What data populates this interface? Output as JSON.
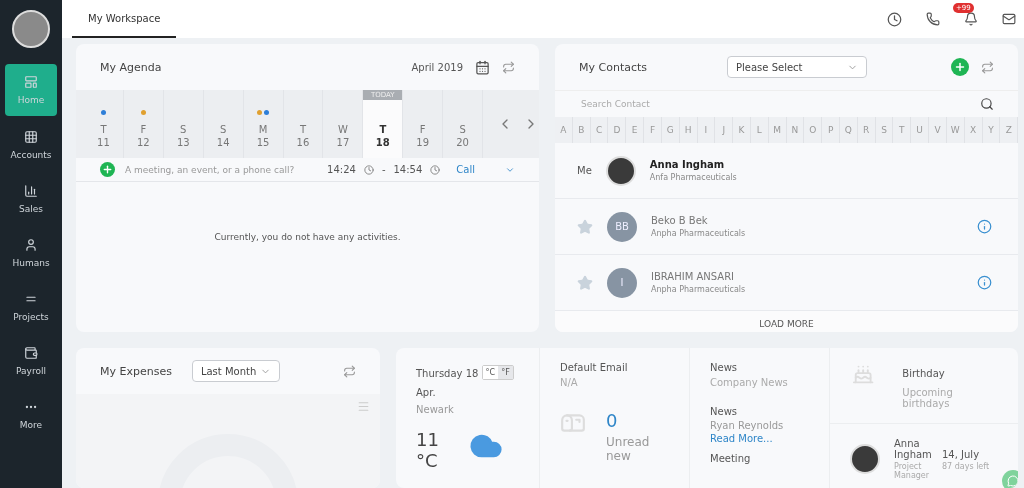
{
  "sidebar": {
    "items": [
      {
        "label": "Home",
        "selected": true
      },
      {
        "label": "Accounts",
        "selected": false
      },
      {
        "label": "Sales",
        "selected": false
      },
      {
        "label": "Humans",
        "selected": false
      },
      {
        "label": "Projects",
        "selected": false
      },
      {
        "label": "Payroll",
        "selected": false
      },
      {
        "label": "More",
        "selected": false
      }
    ]
  },
  "topbar": {
    "tabs": [
      {
        "label": "My Workspace",
        "selected": true
      }
    ],
    "notification_badge": "+99"
  },
  "agenda": {
    "title": "My Agenda",
    "month": "April 2019",
    "today_label": "TODAY",
    "days": [
      {
        "letter": "T",
        "number": "11",
        "today": false,
        "events": [
          {
            "color": "#2f7fd8"
          }
        ]
      },
      {
        "letter": "F",
        "number": "12",
        "today": false,
        "events": [
          {
            "color": "#e0a030"
          }
        ]
      },
      {
        "letter": "S",
        "number": "13",
        "today": false
      },
      {
        "letter": "S",
        "number": "14",
        "today": false
      },
      {
        "letter": "M",
        "number": "15",
        "today": false,
        "events": [
          {
            "color": "#e0a030"
          },
          {
            "color": "#2f7fd8"
          }
        ]
      },
      {
        "letter": "T",
        "number": "16",
        "today": false
      },
      {
        "letter": "W",
        "number": "17",
        "today": false
      },
      {
        "letter": "T",
        "number": "18",
        "today": true
      },
      {
        "letter": "F",
        "number": "19",
        "today": false
      },
      {
        "letter": "S",
        "number": "20",
        "today": false
      }
    ],
    "quick_add": {
      "placeholder": "A meeting, an event, or a phone call?",
      "start": "14:24",
      "separator": "-",
      "end": "14:54",
      "type": "Call"
    },
    "empty_message": "Currently, you do not have any activities."
  },
  "contacts": {
    "title": "My Contacts",
    "filter": "Please Select",
    "search_placeholder": "Search Contact",
    "letters": [
      "A",
      "B",
      "C",
      "D",
      "E",
      "F",
      "G",
      "H",
      "I",
      "J",
      "K",
      "L",
      "M",
      "N",
      "O",
      "P",
      "Q",
      "R",
      "S",
      "T",
      "U",
      "V",
      "W",
      "X",
      "Y",
      "Z"
    ],
    "rows": [
      {
        "kind": "me",
        "label": "Me",
        "name": "Anna Ingham",
        "company": "Anfa Pharmaceuticals"
      },
      {
        "kind": "contact",
        "starred": false,
        "initials": "BB",
        "name": "Beko B Bek",
        "company": "Anpha Pharmaceuticals"
      },
      {
        "kind": "contact",
        "starred": false,
        "initials": "I",
        "name": "IBRAHIM ANSARI",
        "company": "Anpha Pharmaceuticals"
      }
    ],
    "load_more": "LOAD MORE"
  },
  "expenses": {
    "title": "My Expenses",
    "period": "Last Month"
  },
  "weather": {
    "date": "Thursday 18 Apr.",
    "units": [
      {
        "label": "°C",
        "selected": false
      },
      {
        "label": "°F",
        "selected": true
      }
    ],
    "city": "Newark",
    "temperature": "11",
    "unit": "°C"
  },
  "email": {
    "title": "Default Email",
    "address": "N/A",
    "count": "0",
    "caption": "Unread new"
  },
  "news": {
    "title": "News",
    "subtitle": "Company News",
    "items": [
      {
        "title": "News",
        "author": "Ryan Reynolds",
        "link": "Read More..."
      },
      {
        "title": "Meeting"
      }
    ]
  },
  "birthday": {
    "title": "Birthday",
    "subtitle": "Upcoming birthdays",
    "people": [
      {
        "name": "Anna Ingham",
        "date": "14, July",
        "role": "Project Manager",
        "remaining": "87 days left"
      }
    ]
  }
}
